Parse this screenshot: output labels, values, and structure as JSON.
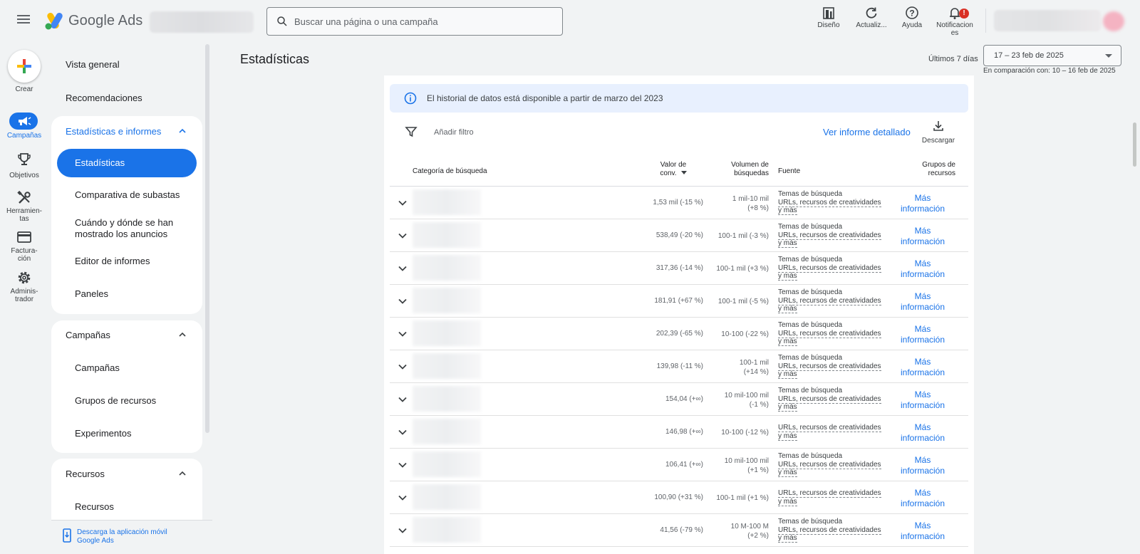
{
  "topbar": {
    "product_name": "Google Ads",
    "search_placeholder": "Buscar una página o una campaña",
    "actions": [
      {
        "label": "Diseño",
        "icon": "layout-icon"
      },
      {
        "label": "Actualiz...",
        "icon": "refresh-icon"
      },
      {
        "label": "Ayuda",
        "icon": "help-icon"
      },
      {
        "label": "Notificaciones",
        "icon": "bell-icon",
        "badge": "!"
      }
    ],
    "notifications_line1": "Notificacion",
    "notifications_line2": "es"
  },
  "rail": {
    "create_label": "Crear",
    "items": [
      {
        "label": "Campañas",
        "icon": "megaphone-icon",
        "active": true
      },
      {
        "label": "Objetivos",
        "icon": "trophy-icon"
      },
      {
        "label_line1": "Herramien-",
        "label_line2": "tas",
        "icon": "tools-icon"
      },
      {
        "label_line1": "Factura-",
        "label_line2": "ción",
        "icon": "credit-card-icon"
      },
      {
        "label_line1": "Adminis-",
        "label_line2": "trador",
        "icon": "gear-icon"
      }
    ]
  },
  "nav": {
    "overview": "Vista general",
    "recommendations": "Recomendaciones",
    "insights_section": {
      "title": "Estadísticas e informes",
      "items": [
        "Estadísticas",
        "Comparativa de subastas",
        "Cuándo y dónde se han",
        "mostrado los anuncios",
        "Editor de informes",
        "Paneles"
      ]
    },
    "campaigns_section": {
      "title": "Campañas",
      "items": [
        "Campañas",
        "Grupos de recursos",
        "Experimentos"
      ]
    },
    "resources_section": {
      "title": "Recursos",
      "items": [
        "Recursos"
      ]
    },
    "app_download_line1": "Descarga la aplicación móvil",
    "app_download_line2": "Google Ads"
  },
  "page": {
    "title": "Estadísticas",
    "date_caption": "Últimos 7 días",
    "date_range": "17 – 23 feb de 2025",
    "comparison": "En comparación con: 10 – 16 feb de 2025"
  },
  "card": {
    "banner_text": "El historial de datos está disponible a partir de marzo del 2023",
    "filter_placeholder": "Añadir filtro",
    "report_link": "Ver informe detallado",
    "download_label": "Descargar",
    "columns": {
      "category": "Categoría de búsqueda",
      "conv_value_1": "Valor de",
      "conv_value_2": "conv.",
      "volume_1": "Volumen de",
      "volume_2": "búsquedas",
      "source": "Fuente",
      "groups_1": "Grupos de",
      "groups_2": "recursos"
    },
    "source_line1": "Temas de búsqueda",
    "source_line2": "URLs, recursos de creatividades",
    "source_line3": "y más",
    "more_line1": "Más",
    "more_line2": "información",
    "rows": [
      {
        "conv": "1,53 mil (-15 %)",
        "vol1": "1 mil-10 mil",
        "vol2": "(+8 %)",
        "topics": true
      },
      {
        "conv": "538,49 (-20 %)",
        "vol1": "100-1 mil (-3 %)",
        "vol2": "",
        "topics": true
      },
      {
        "conv": "317,36 (-14 %)",
        "vol1": "100-1 mil (+3 %)",
        "vol2": "",
        "topics": true
      },
      {
        "conv": "181,91 (+67 %)",
        "vol1": "100-1 mil (-5 %)",
        "vol2": "",
        "topics": true
      },
      {
        "conv": "202,39 (-65 %)",
        "vol1": "10-100 (-22 %)",
        "vol2": "",
        "topics": true
      },
      {
        "conv": "139,98 (-11 %)",
        "vol1": "100-1 mil",
        "vol2": "(+14 %)",
        "topics": true
      },
      {
        "conv": "154,04 (+∞)",
        "vol1": "10 mil-100 mil",
        "vol2": "(-1 %)",
        "topics": true
      },
      {
        "conv": "146,98 (+∞)",
        "vol1": "10-100 (-12 %)",
        "vol2": "",
        "topics": false
      },
      {
        "conv": "106,41 (+∞)",
        "vol1": "10 mil-100 mil",
        "vol2": "(+1 %)",
        "topics": true
      },
      {
        "conv": "100,90 (+31 %)",
        "vol1": "100-1 mil (+1 %)",
        "vol2": "",
        "topics": false
      },
      {
        "conv": "41,56 (-79 %)",
        "vol1": "10 M-100 M",
        "vol2": "(+2 %)",
        "topics": true
      }
    ]
  },
  "colors": {
    "accent": "#1a73e8",
    "background": "#f1f3f4",
    "banner": "#e8f0fe",
    "notification_badge": "#d93025"
  }
}
